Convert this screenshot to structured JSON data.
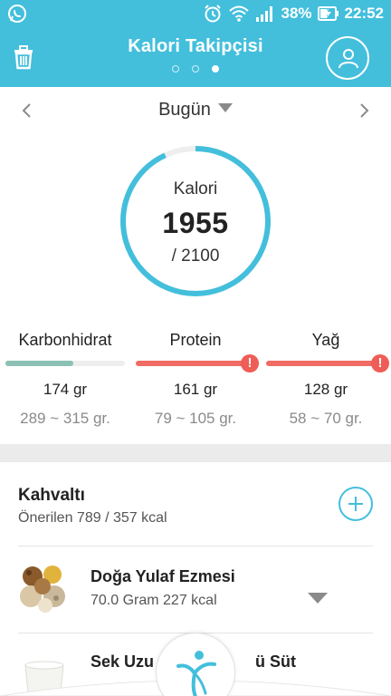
{
  "status_bar": {
    "battery_percent": "38%",
    "time": "22:52",
    "icons": [
      "whatsapp-icon",
      "alarm-icon",
      "wifi-icon",
      "signal-icon",
      "battery-charging-icon"
    ]
  },
  "header": {
    "title": "Kalori Takipçisi",
    "pager_total": 3,
    "pager_active": 3,
    "left_icon": "trash-icon",
    "right_icon": "profile-icon"
  },
  "date_nav": {
    "selected": "Bugün",
    "prev_icon": "chevron-left-icon",
    "next_icon": "chevron-right-icon"
  },
  "calorie_ring": {
    "label": "Kalori",
    "value": "1955",
    "goal": "/ 2100",
    "consumed": 1955,
    "target": 2100
  },
  "macros": [
    {
      "name": "Karbonhidrat",
      "amount": "174 gr",
      "range": "289 ~ 315 gr.",
      "fill_fraction": 0.57,
      "color": "#8cc0b5",
      "warning": false
    },
    {
      "name": "Protein",
      "amount": "161 gr",
      "range": "79 ~ 105 gr.",
      "fill_fraction": 1.0,
      "color": "#ef6b64",
      "warning": true
    },
    {
      "name": "Yağ",
      "amount": "128 gr",
      "range": "58 ~ 70 gr.",
      "fill_fraction": 1.0,
      "color": "#ef6b64",
      "warning": true
    }
  ],
  "meal": {
    "title": "Kahvaltı",
    "subtitle": "Önerilen 789 / 357 kcal",
    "foods": [
      {
        "name": "Doğa Yulaf Ezmesi",
        "detail": "70.0 Gram 227 kcal"
      },
      {
        "name": "Sek Uzu",
        "name_tail": "ü Süt",
        "detail": ""
      }
    ]
  },
  "colors": {
    "accent": "#43bfdc",
    "warning": "#ef5d57",
    "carb_bar": "#8cc0b5"
  }
}
